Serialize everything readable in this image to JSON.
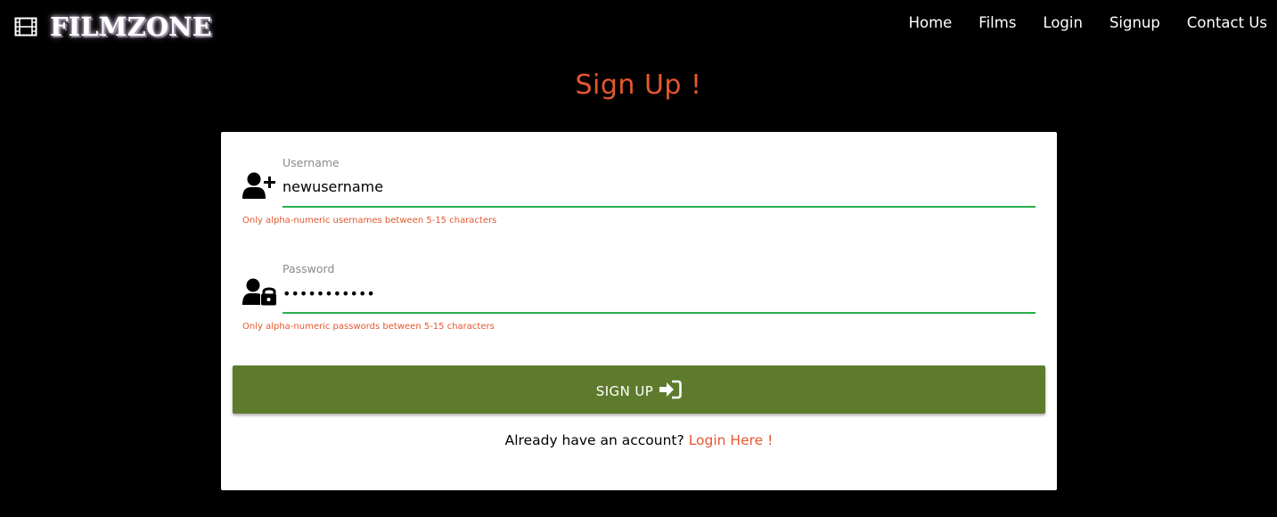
{
  "navbar": {
    "brand_text": "FILMZONE",
    "brand_icon": "film-icon",
    "links": [
      "Home",
      "Films",
      "Login",
      "Signup",
      "Contact Us"
    ]
  },
  "page": {
    "title": "Sign Up !"
  },
  "form": {
    "username": {
      "label": "Username",
      "value": "newusername",
      "icon": "user-plus-icon",
      "helper": "Only alpha-numeric usernames between 5-15 characters"
    },
    "password": {
      "label": "Password",
      "value": "secretpasss",
      "icon": "user-lock-icon",
      "helper": "Only alpha-numeric passwords between 5-15 characters"
    },
    "submit_label": "SIGN UP",
    "submit_icon": "sign-in-icon",
    "login_prompt": "Already have an account?",
    "login_link": "Login Here !"
  },
  "colors": {
    "background": "#000000",
    "accent": "#e4582f",
    "button": "#5e7b2d",
    "underline_valid": "#27b04a",
    "card": "#ffffff"
  }
}
